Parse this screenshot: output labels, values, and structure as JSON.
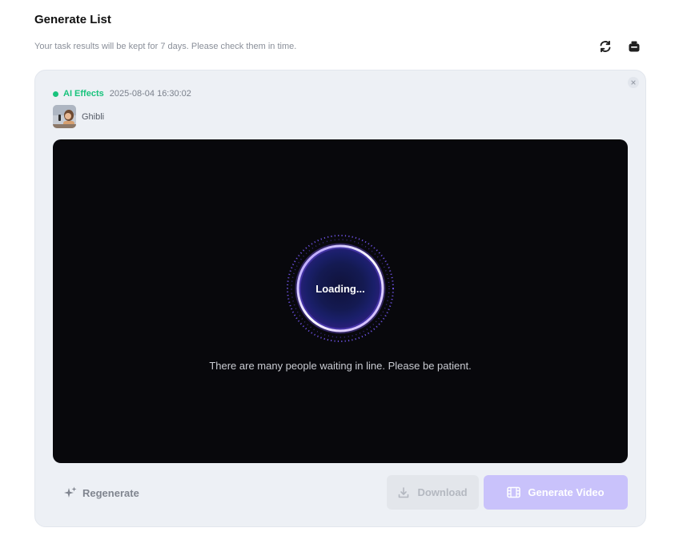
{
  "header": {
    "title": "Generate List",
    "subtitle": "Your task results will be kept for 7 days. Please check them in time.",
    "refresh_icon": "refresh-icon",
    "clear_icon": "clear-icon"
  },
  "task": {
    "type": "AI Effects",
    "timestamp": "2025-08-04 16:30:02",
    "effect_name": "Ghibli",
    "status_color": "#19c37d",
    "preview": {
      "loading_text": "Loading...",
      "waiting_message": "There are many people waiting in line. Please be patient."
    },
    "actions": {
      "regenerate_label": "Regenerate",
      "download_label": "Download",
      "generate_video_label": "Generate Video"
    }
  },
  "colors": {
    "accent": "#c9c2fb",
    "success": "#19c37d",
    "preview_bg": "#08080c"
  }
}
